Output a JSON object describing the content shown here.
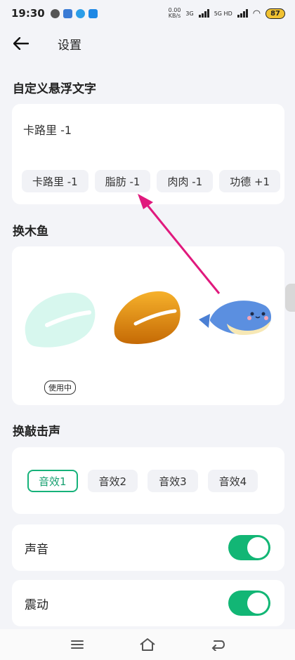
{
  "status_bar": {
    "time": "19:30",
    "net_speed_value": "0.00",
    "net_speed_unit": "KB/s",
    "network_1": "3G",
    "network_2": "5G HD",
    "battery": "87"
  },
  "header": {
    "title": "设置"
  },
  "float_text": {
    "section_title": "自定义悬浮文字",
    "current_text": "卡路里 -1",
    "options": [
      "卡路里 -1",
      "脂肪 -1",
      "肉肉 -1",
      "功德 +1"
    ]
  },
  "fish": {
    "section_title": "换木鱼",
    "in_use_label": "使用中"
  },
  "sound_effect": {
    "section_title": "换敲击声",
    "options": [
      "音效1",
      "音效2",
      "音效3",
      "音效4"
    ],
    "selected_index": 0
  },
  "toggles": {
    "sound_label": "声音",
    "sound_on": true,
    "vibration_label": "震动",
    "vibration_on": true
  },
  "colors": {
    "accent": "#12b675",
    "annotation_arrow": "#e0197d",
    "background": "#f3f4f8"
  }
}
